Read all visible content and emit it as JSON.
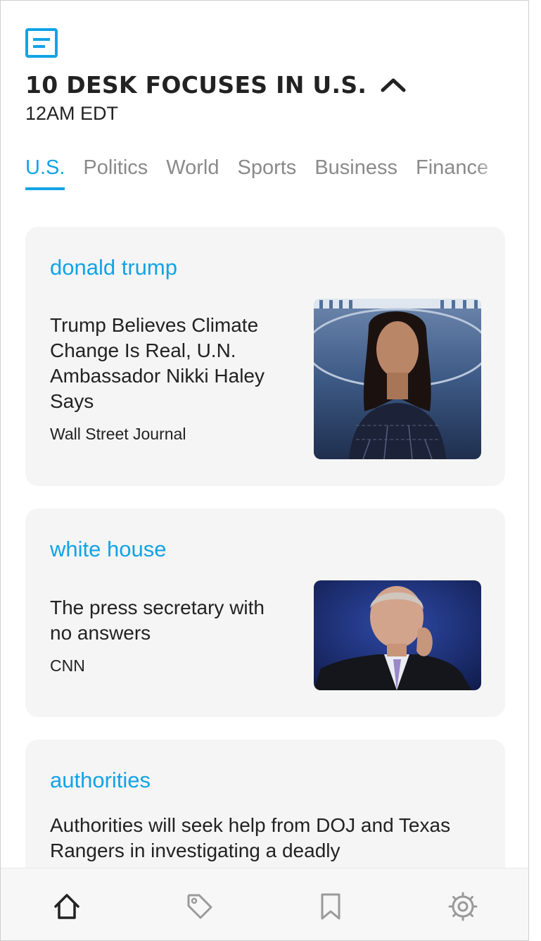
{
  "header": {
    "app_icon": "news-list-icon",
    "title": "10 DESK FOCUSES IN U.S.",
    "subtitle": "12AM EDT",
    "collapse_icon": "chevron-up-icon"
  },
  "tabs": [
    {
      "label": "U.S.",
      "active": true
    },
    {
      "label": "Politics",
      "active": false
    },
    {
      "label": "World",
      "active": false
    },
    {
      "label": "Sports",
      "active": false
    },
    {
      "label": "Business",
      "active": false
    },
    {
      "label": "Finance",
      "active": false
    }
  ],
  "stories": [
    {
      "topic": "donald trump",
      "headline": "Trump Believes Climate Change Is Real, U.N. Ambassador Nikki Haley Says",
      "source": "Wall Street Journal",
      "image": "photo-woman-speaking-at-podium"
    },
    {
      "topic": "white house",
      "headline": "The press secretary with no answers",
      "source": "CNN",
      "image": "photo-man-in-suit"
    },
    {
      "topic": "authorities",
      "headline": "Authorities will seek help from DOJ and Texas Rangers in investigating a deadly",
      "source": "",
      "image": ""
    }
  ],
  "bottom_nav": [
    {
      "icon": "home-icon",
      "active": true
    },
    {
      "icon": "tag-icon",
      "active": false
    },
    {
      "icon": "bookmark-icon",
      "active": false
    },
    {
      "icon": "settings-icon",
      "active": false
    }
  ],
  "colors": {
    "accent": "#12a3e6",
    "card_bg": "#f5f5f5",
    "text": "#222222",
    "inactive_tab": "#8a8a8a"
  }
}
